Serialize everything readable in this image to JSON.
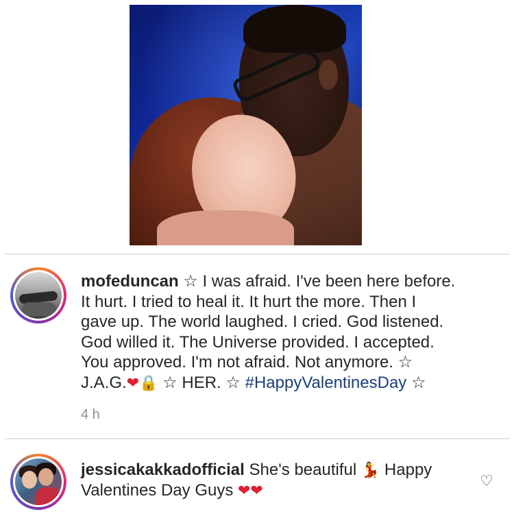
{
  "post": {
    "image_alt": "Couple photo",
    "caption": {
      "username": "mofeduncan",
      "line1_text": " I was afraid. I've been here before.",
      "line2": "It hurt. I tried to heal it. It hurt the more. Then I",
      "line3": "gave up. The world laughed. I cried. God listened.",
      "line4": "God willed it. The Universe provided. I accepted.",
      "line5": "You approved. I'm not afraid. Not anymore.",
      "line6_prefix": "J.A.G.",
      "line6_her": " HER. ",
      "hashtag": "#HappyValentinesDay",
      "star": "☆",
      "heart": "❤",
      "lock": "🔒"
    },
    "timestamp": "4 h"
  },
  "reply": {
    "username": "jessicakakkadofficial",
    "text_part1": " She's beautiful ",
    "dancer": "💃",
    "text_part2": " Happy",
    "line2": "Valentines Day Guys ",
    "hearts": "❤❤"
  },
  "icons": {
    "like": "heart-outline-icon"
  },
  "colors": {
    "hashtag": "#1c3f78",
    "heart": "#e0202f",
    "timestamp": "#8e8e8e"
  }
}
